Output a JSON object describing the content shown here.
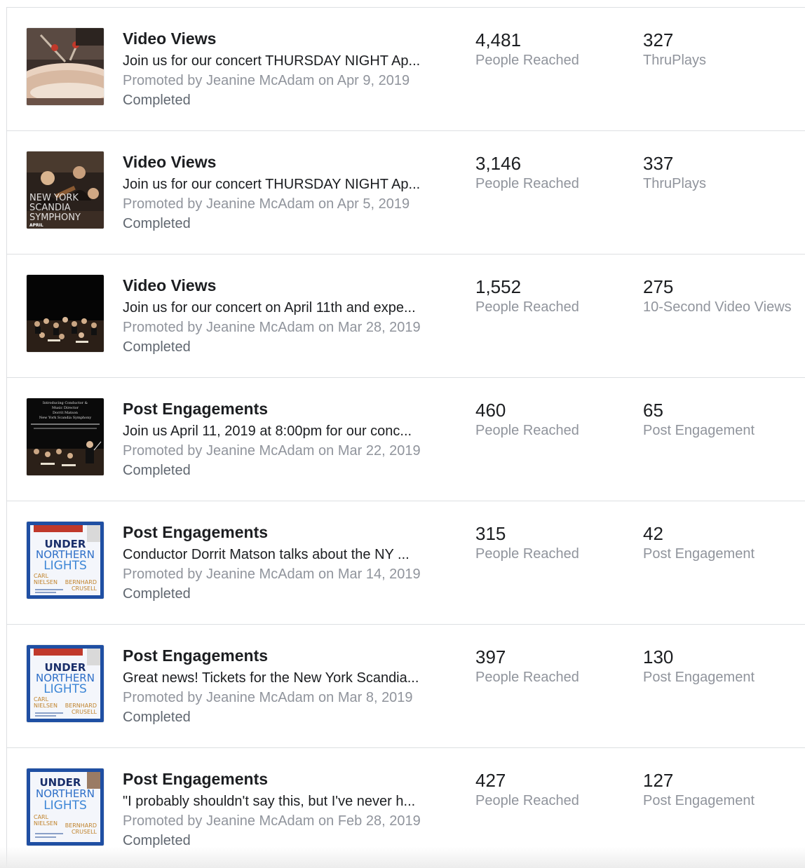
{
  "promotions": [
    {
      "title": "Video Views",
      "description": "Join us for our concert THURSDAY NIGHT Ap...",
      "promoted": "Promoted by Jeanine McAdam on Apr 9, 2019",
      "status": "Completed",
      "metric1": {
        "value": "4,481",
        "label": "People Reached"
      },
      "metric2": {
        "value": "327",
        "label": "ThruPlays"
      },
      "thumbnail": "percussion-drum-image"
    },
    {
      "title": "Video Views",
      "description": "Join us for our concert THURSDAY NIGHT Ap...",
      "promoted": "Promoted by Jeanine McAdam on Apr 5, 2019",
      "status": "Completed",
      "metric1": {
        "value": "3,146",
        "label": "People Reached"
      },
      "metric2": {
        "value": "337",
        "label": "ThruPlays"
      },
      "thumbnail": "orchestra-photo-image",
      "thumb_text": [
        "NEW YORK",
        "SCANDIA",
        "SYMPHONY",
        "APRIL"
      ]
    },
    {
      "title": "Video Views",
      "description": "Join us for our concert on April 11th and expe...",
      "promoted": "Promoted by Jeanine McAdam on Mar 28, 2019",
      "status": "Completed",
      "metric1": {
        "value": "1,552",
        "label": "People Reached"
      },
      "metric2": {
        "value": "275",
        "label": "10-Second Video Views"
      },
      "thumbnail": "orchestra-stage-image"
    },
    {
      "title": "Post Engagements",
      "description": "Join us April 11, 2019 at 8:00pm for our conc...",
      "promoted": "Promoted by Jeanine McAdam on Mar 22, 2019",
      "status": "Completed",
      "metric1": {
        "value": "460",
        "label": "People Reached"
      },
      "metric2": {
        "value": "65",
        "label": "Post Engagement"
      },
      "thumbnail": "conductor-intro-image",
      "thumb_text": [
        "Introducing Conductor &",
        "Music Director",
        "Dorrit Matson",
        "New York Scandia Symphony"
      ]
    },
    {
      "title": "Post Engagements",
      "description": "Conductor Dorrit Matson talks about the NY ...",
      "promoted": "Promoted by Jeanine McAdam on Mar 14, 2019",
      "status": "Completed",
      "metric1": {
        "value": "315",
        "label": "People Reached"
      },
      "metric2": {
        "value": "42",
        "label": "Post Engagement"
      },
      "thumbnail": "under-northern-lights-poster",
      "thumb_text": [
        "UNDER",
        "NORTHERN",
        "LIGHTS",
        "CARL",
        "NIELSEN",
        "BERNHARD",
        "CRUSELL"
      ]
    },
    {
      "title": "Post Engagements",
      "description": "Great news! Tickets for the New York Scandia...",
      "promoted": "Promoted by Jeanine McAdam on Mar 8, 2019",
      "status": "Completed",
      "metric1": {
        "value": "397",
        "label": "People Reached"
      },
      "metric2": {
        "value": "130",
        "label": "Post Engagement"
      },
      "thumbnail": "under-northern-lights-poster",
      "thumb_text": [
        "UNDER",
        "NORTHERN",
        "LIGHTS",
        "CARL",
        "NIELSEN",
        "BERNHARD",
        "CRUSELL"
      ]
    },
    {
      "title": "Post Engagements",
      "description": "\"I probably shouldn't say this, but I've never h...",
      "promoted": "Promoted by Jeanine McAdam on Feb 28, 2019",
      "status": "Completed",
      "metric1": {
        "value": "427",
        "label": "People Reached"
      },
      "metric2": {
        "value": "127",
        "label": "Post Engagement"
      },
      "thumbnail": "under-northern-lights-poster",
      "thumb_text": [
        "UNDER",
        "NORTHERN",
        "LIGHTS",
        "CARL",
        "NIELSEN",
        "BERNHARD",
        "CRUSELL"
      ]
    }
  ],
  "colors": {
    "text_primary": "#1c1e21",
    "text_secondary": "#90949c",
    "divider": "#dddfe2",
    "poster_blue": "#1f4fa3"
  }
}
